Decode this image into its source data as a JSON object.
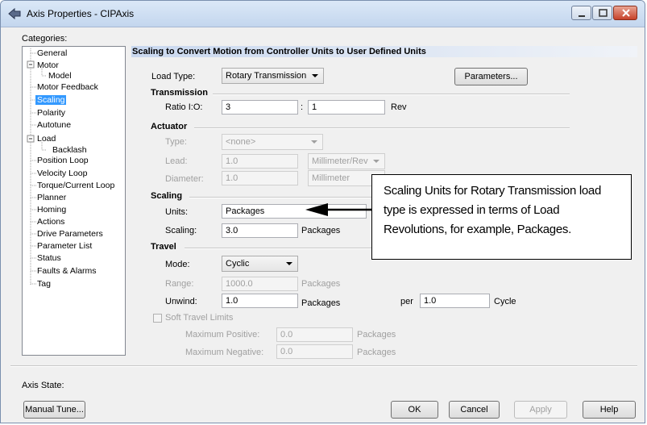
{
  "window": {
    "title": "Axis Properties - CIPAxis"
  },
  "categories": {
    "label": "Categories:",
    "items": [
      "General",
      "Motor",
      "Model",
      "Motor Feedback",
      "Scaling",
      "Polarity",
      "Autotune",
      "Load",
      "Backlash",
      "Position Loop",
      "Velocity Loop",
      "Torque/Current Loop",
      "Planner",
      "Homing",
      "Actions",
      "Drive Parameters",
      "Parameter List",
      "Status",
      "Faults & Alarms",
      "Tag"
    ],
    "selected": "Scaling"
  },
  "header": "Scaling to Convert Motion from Controller Units to User Defined Units",
  "load_type": {
    "label": "Load Type:",
    "value": "Rotary Transmission"
  },
  "parameters_button": "Parameters...",
  "transmission": {
    "title": "Transmission",
    "ratio_label": "Ratio I:O:",
    "ratio_input": "3",
    "colon": ":",
    "ratio_output": "1",
    "unit": "Rev"
  },
  "actuator": {
    "title": "Actuator",
    "type_label": "Type:",
    "type_value": "<none>",
    "lead_label": "Lead:",
    "lead_value": "1.0",
    "lead_unit": "Millimeter/Rev",
    "diameter_label": "Diameter:",
    "diameter_value": "1.0",
    "diameter_unit": "Millimeter"
  },
  "scaling": {
    "title": "Scaling",
    "units_label": "Units:",
    "units_value": "Packages",
    "scaling_label": "Scaling:",
    "scaling_value": "3.0",
    "scaling_unit": "Packages"
  },
  "travel": {
    "title": "Travel",
    "mode_label": "Mode:",
    "mode_value": "Cyclic",
    "range_label": "Range:",
    "range_value": "1000.0",
    "range_unit": "Packages",
    "unwind_label": "Unwind:",
    "unwind_value": "1.0",
    "unwind_unit": "Packages",
    "per_label": "per",
    "per_value": "1.0",
    "per_unit": "Cycle",
    "soft_limits_label": "Soft Travel Limits",
    "max_pos_label": "Maximum Positive:",
    "max_pos_value": "0.0",
    "max_pos_unit": "Packages",
    "max_neg_label": "Maximum Negative:",
    "max_neg_value": "0.0",
    "max_neg_unit": "Packages"
  },
  "callout": {
    "line1": "Scaling Units for Rotary Transmission load",
    "line2": "type is expressed in terms of Load",
    "line3": "Revolutions, for example, Packages."
  },
  "footer": {
    "axis_state_label": "Axis State:",
    "manual_tune": "Manual Tune...",
    "ok": "OK",
    "cancel": "Cancel",
    "apply": "Apply",
    "help": "Help"
  },
  "colors": {
    "selection": "#3399ff",
    "header_gradient": "#c9d8ef",
    "close_button": "#c7422a"
  }
}
